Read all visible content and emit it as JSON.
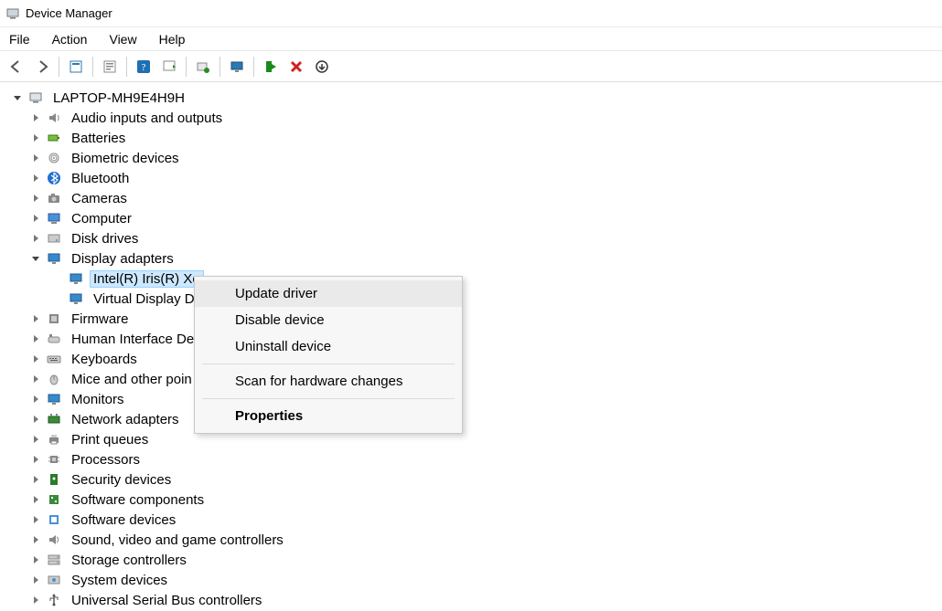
{
  "window": {
    "title": "Device Manager"
  },
  "menubar": {
    "file": "File",
    "action": "Action",
    "view": "View",
    "help": "Help"
  },
  "toolbar_icons": {
    "back": "back-arrow-icon",
    "forward": "forward-arrow-icon",
    "show_hidden": "show-hidden-devices-icon",
    "properties": "properties-icon",
    "help": "help-icon",
    "scan": "scan-hardware-icon",
    "update": "update-driver-icon",
    "monitor": "monitor-icon",
    "enable": "enable-device-icon",
    "remove": "uninstall-device-icon",
    "down": "legacy-add-icon"
  },
  "tree": {
    "root": "LAPTOP-MH9E4H9H",
    "categories": [
      {
        "label": "Audio inputs and outputs",
        "icon": "speaker-icon"
      },
      {
        "label": "Batteries",
        "icon": "battery-icon"
      },
      {
        "label": "Biometric devices",
        "icon": "fingerprint-icon"
      },
      {
        "label": "Bluetooth",
        "icon": "bluetooth-icon"
      },
      {
        "label": "Cameras",
        "icon": "camera-icon"
      },
      {
        "label": "Computer",
        "icon": "computer-icon"
      },
      {
        "label": "Disk drives",
        "icon": "disk-icon"
      },
      {
        "label": "Display adapters",
        "icon": "display-icon",
        "expanded": true,
        "children": [
          {
            "label": "Intel(R) Iris(R) Xe Graphics",
            "icon": "display-icon",
            "selected": true,
            "truncatedTo": "Intel(R) Iris(R) Xe "
          },
          {
            "label": "Virtual Display Device",
            "icon": "display-icon",
            "truncatedTo": "Virtual Display De"
          }
        ]
      },
      {
        "label": "Firmware",
        "icon": "firmware-icon"
      },
      {
        "label": "Human Interface Devices",
        "icon": "hid-icon",
        "truncatedTo": "Human Interface Dev"
      },
      {
        "label": "Keyboards",
        "icon": "keyboard-icon"
      },
      {
        "label": "Mice and other pointing devices",
        "icon": "mouse-icon",
        "truncatedTo": "Mice and other poin"
      },
      {
        "label": "Monitors",
        "icon": "monitor-icon"
      },
      {
        "label": "Network adapters",
        "icon": "nic-icon"
      },
      {
        "label": "Print queues",
        "icon": "printer-icon"
      },
      {
        "label": "Processors",
        "icon": "cpu-icon"
      },
      {
        "label": "Security devices",
        "icon": "security-icon"
      },
      {
        "label": "Software components",
        "icon": "swcomp-icon"
      },
      {
        "label": "Software devices",
        "icon": "swdev-icon"
      },
      {
        "label": "Sound, video and game controllers",
        "icon": "sound-icon"
      },
      {
        "label": "Storage controllers",
        "icon": "storage-icon"
      },
      {
        "label": "System devices",
        "icon": "system-icon"
      },
      {
        "label": "Universal Serial Bus controllers",
        "icon": "usb-icon",
        "truncatedTo": "Universal Serial Bus controllers"
      }
    ]
  },
  "context_menu": {
    "items": [
      {
        "label": "Update driver",
        "hover": true
      },
      {
        "label": "Disable device"
      },
      {
        "label": "Uninstall device"
      },
      {
        "sep": true
      },
      {
        "label": "Scan for hardware changes"
      },
      {
        "sep": true
      },
      {
        "label": "Properties",
        "bold": true
      }
    ]
  }
}
